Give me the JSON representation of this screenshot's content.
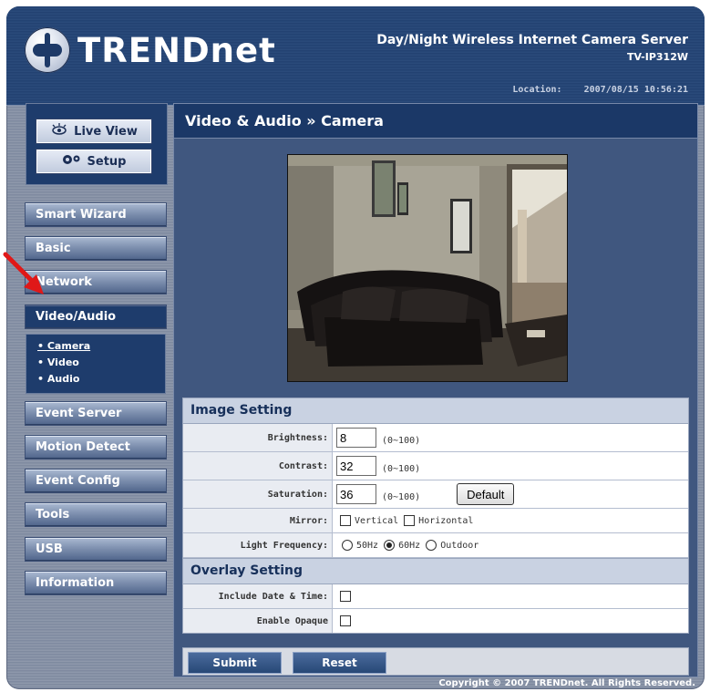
{
  "header": {
    "brand": "TRENDnet",
    "product_title": "Day/Night Wireless Internet Camera Server",
    "model": "TV-IP312W",
    "location_label": "Location:",
    "datetime": "2007/08/15 10:56:21"
  },
  "top_nav": {
    "live_view": "Live View",
    "setup": "Setup"
  },
  "menu": {
    "smart_wizard": "Smart Wizard",
    "basic": "Basic",
    "network": "Network",
    "video_audio": "Video/Audio",
    "sub": {
      "camera": "• Camera",
      "video": "• Video",
      "audio": "• Audio"
    },
    "event_server": "Event Server",
    "motion_detect": "Motion Detect",
    "event_config": "Event Config",
    "tools": "Tools",
    "usb": "USB",
    "information": "Information"
  },
  "page": {
    "title": "Video & Audio » Camera"
  },
  "image_setting": {
    "heading": "Image Setting",
    "brightness_label": "Brightness:",
    "brightness_value": "8",
    "contrast_label": "Contrast:",
    "contrast_value": "32",
    "saturation_label": "Saturation:",
    "saturation_value": "36",
    "range": "(0~100)",
    "default_button": "Default",
    "mirror_label": "Mirror:",
    "mirror_vertical": "Vertical",
    "mirror_horizontal": "Horizontal",
    "freq_label": "Light Frequency:",
    "freq_50": "50Hz",
    "freq_60": "60Hz",
    "freq_outdoor": "Outdoor",
    "freq_selected": "60Hz"
  },
  "overlay_setting": {
    "heading": "Overlay Setting",
    "include_date_label": "Include Date & Time:",
    "enable_opaque_label": "Enable Opaque"
  },
  "actions": {
    "submit": "Submit",
    "reset": "Reset"
  },
  "footer": {
    "copyright": "Copyright © 2007 TRENDnet. All Rights Reserved."
  },
  "colors": {
    "header_bg": "#2a4a7a",
    "panel_bg": "#40577f",
    "title_bar": "#1b3867",
    "active_menu": "#1e3c6c",
    "arrow": "#e01818"
  }
}
